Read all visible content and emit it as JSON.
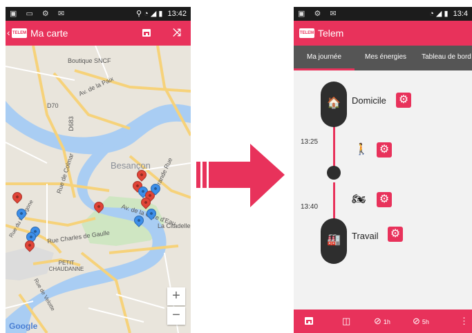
{
  "left_phone": {
    "statusbar": {
      "left_icons": "▣ ▭ ⚙ ✉",
      "right_icons": "⚲ ◔ ◢ ▮",
      "time": "13:42"
    },
    "appbar": {
      "title": "Ma carte",
      "logo": "TELEM"
    },
    "map": {
      "labels": {
        "boutique": "Boutique SNCF",
        "av_paix": "Av. de la Paix",
        "d70": "D70",
        "d683": "D683",
        "besancon": "Besançon",
        "rue_colmar": "Rue de Colmar",
        "grande_rue": "Grande Rue",
        "av_gare": "Av. de la Gare d'Eau",
        "la_citadelle": "La Citadelle",
        "rue_charles": "Rue Charles de Gaulle",
        "petit_chaudanne": "PETIT CHAUDANNE",
        "rue_polygone": "Rue du Polygone",
        "rue_velotte": "Rue de Velotte"
      },
      "zoom_in": "+",
      "zoom_out": "−",
      "attribution": "Google"
    }
  },
  "right_phone": {
    "statusbar": {
      "left_icons": "▣ ⚙ ✉",
      "right_icons": "◔ ◢ ▮",
      "time": "13:4"
    },
    "appbar": {
      "title": "Telem",
      "logo": "TELEM"
    },
    "tabs": [
      {
        "label": "Ma journée"
      },
      {
        "label": "Mes énergies"
      },
      {
        "label": "Tableau de bord"
      }
    ],
    "timeline": {
      "start": {
        "label": "Domicile",
        "icon": "🏠"
      },
      "end": {
        "label": "Travail",
        "icon": "🏭"
      },
      "time_start": "13:25",
      "time_end": "13:40",
      "walk_icon": "🚶",
      "moto_icon": "🏍"
    },
    "bottombar": {
      "item1": "1h",
      "item2": "5h",
      "more": "⋮"
    }
  },
  "colors": {
    "accent": "#e8325b",
    "dark": "#2e2e2e",
    "tab_bar": "#555555",
    "pin_red": "#e04437",
    "pin_blue": "#3d8ee8"
  }
}
